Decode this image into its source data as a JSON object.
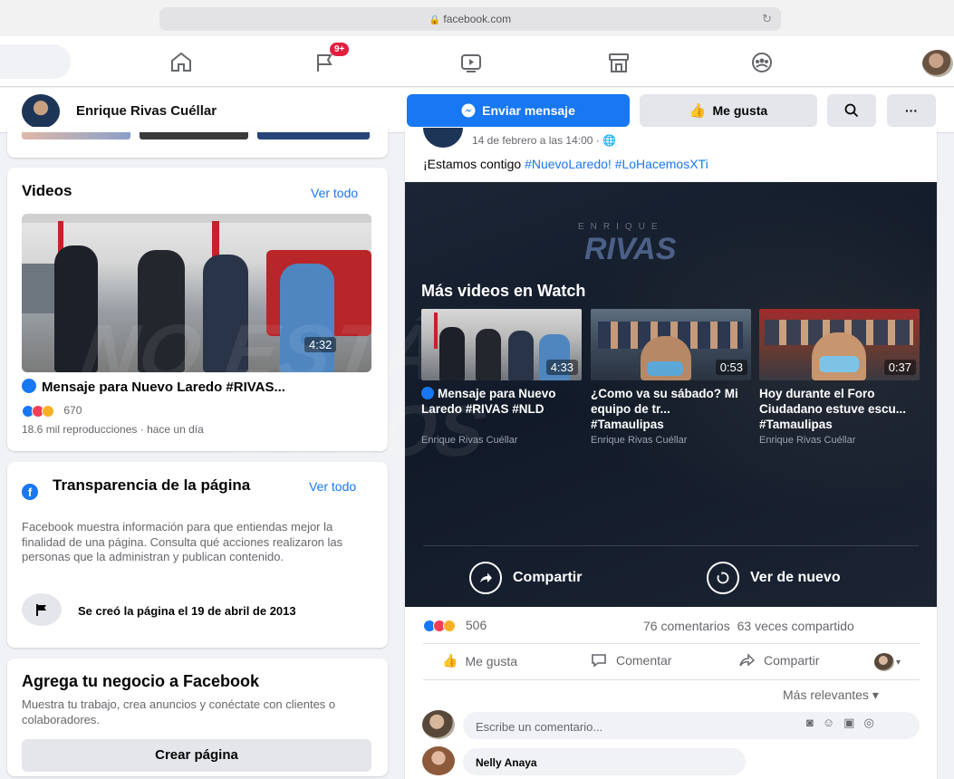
{
  "browser": {
    "url": "facebook.com"
  },
  "nav": {
    "icons": [
      "home-icon",
      "flag-icon",
      "watch-icon",
      "marketplace-icon",
      "groups-icon"
    ],
    "badge": "9+"
  },
  "page": {
    "name": "Enrique Rivas Cuéllar",
    "send_message": "Enviar mensaje",
    "like": "Me gusta"
  },
  "videos": {
    "title": "Videos",
    "see_all": "Ver todo",
    "duration": "4:32",
    "video_title": "Mensaje para Nuevo Laredo #RIVAS...",
    "reactions": "670",
    "meta": "18.6 mil reproducciones · hace un día"
  },
  "transparency": {
    "title": "Transparencia de la página",
    "see_all": "Ver todo",
    "text": "Facebook muestra información para que entiendas mejor la finalidad de una página. Consulta qué acciones realizaron las personas que la administran y publican contenido.",
    "created": "Se creó la página el 19 de abril de 2013"
  },
  "business": {
    "title": "Agrega tu negocio a Facebook",
    "text": "Muestra tu trabajo, crea anuncios y conéctate con clientes o colaboradores.",
    "button": "Crear página"
  },
  "post": {
    "date": "14 de febrero a las 14:00 · ",
    "text_prefix": "¡Estamos contigo ",
    "tag1": "#NuevoLaredo!",
    "tag2": "#LoHacemosXTi",
    "reactions": "506",
    "comments": "76 comentarios",
    "shares": "63 veces compartido",
    "actions": {
      "like": "Me gusta",
      "comment": "Comentar",
      "share": "Compartir"
    },
    "sort": "Más relevantes",
    "comment_placeholder": "Escribe un comentario...",
    "commenter": "Nelly Anaya"
  },
  "watch": {
    "brand_small": "ENRIQUE",
    "brand_big": "RIVAS",
    "watermark_1": "NO ESTÁN",
    "watermark_2": "SOLOS",
    "title": "Más videos en Watch",
    "items": [
      {
        "duration": "4:33",
        "title": "Mensaje para Nuevo Laredo #RIVAS #NLD",
        "author": "Enrique Rivas Cuéllar"
      },
      {
        "duration": "0:53",
        "title": "¿Como va su sábado? Mi equipo de tr... #Tamaulipas",
        "author": "Enrique Rivas Cuéllar"
      },
      {
        "duration": "0:37",
        "title": "Hoy durante el Foro Ciudadano estuve escu... #Tamaulipas",
        "author": "Enrique Rivas Cuéllar"
      }
    ],
    "share": "Compartir",
    "replay": "Ver de nuevo"
  }
}
